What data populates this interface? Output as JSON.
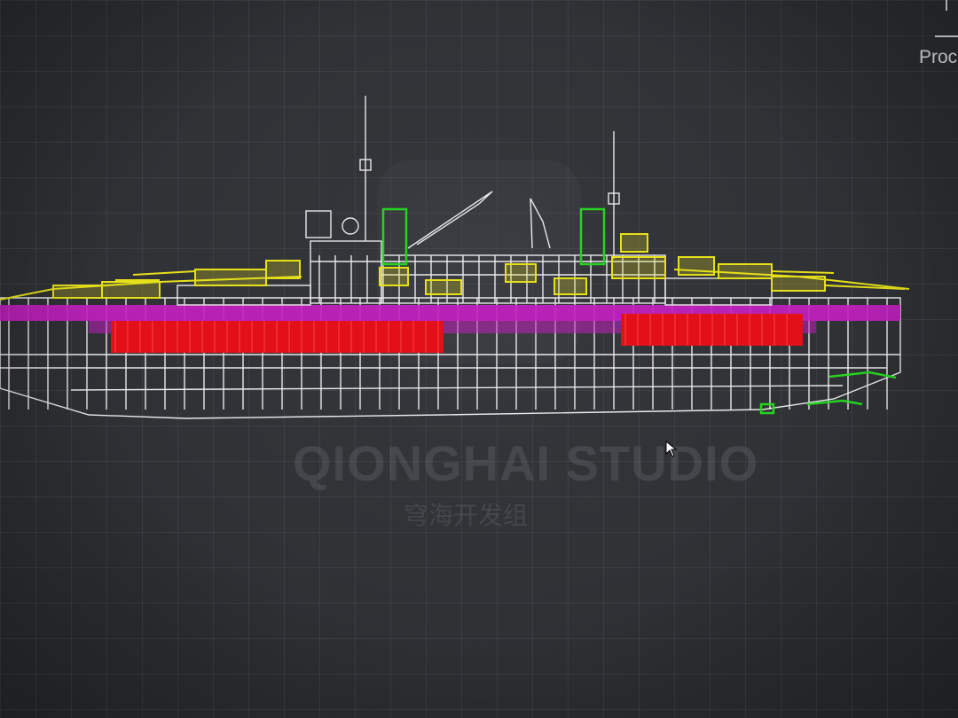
{
  "watermark": {
    "studio_name": "QIONGHAI STUDIO",
    "studio_name_cn": "穹海开发组"
  },
  "panel": {
    "label": "Proc"
  },
  "icons": {
    "cursor": "arrow-cursor-icon",
    "watermark": "studio-emblem-icon"
  },
  "colors": {
    "background": "#2d2f33",
    "wireframe_white": "#e9e9e9",
    "weapons_yellow": "#e6e01a",
    "armor_magenta": "#c21fbf",
    "magazine_red": "#e3101a",
    "selection_green": "#27d321"
  }
}
